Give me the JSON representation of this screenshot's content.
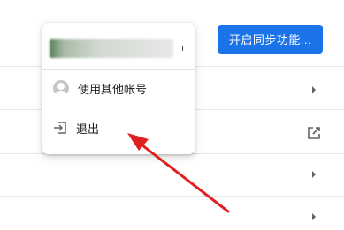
{
  "header": {
    "sync_button_label": "开启同步功能..."
  },
  "profile_menu": {
    "account_name": "",
    "account_suffix": "ı",
    "items": [
      {
        "label": "使用其他帐号",
        "icon": "account-circle-icon"
      },
      {
        "label": "退出",
        "icon": "logout-icon"
      }
    ]
  },
  "settings_rows": [
    {
      "icon": "chevron-right-icon"
    },
    {
      "icon": "external-link-icon"
    },
    {
      "icon": "chevron-right-icon"
    },
    {
      "icon": "chevron-right-icon"
    }
  ],
  "annotation": {
    "color": "#e02020",
    "icon": "red-arrow-annotation"
  },
  "colors": {
    "accent": "#1a73e8",
    "divider": "#e6e6e6"
  }
}
